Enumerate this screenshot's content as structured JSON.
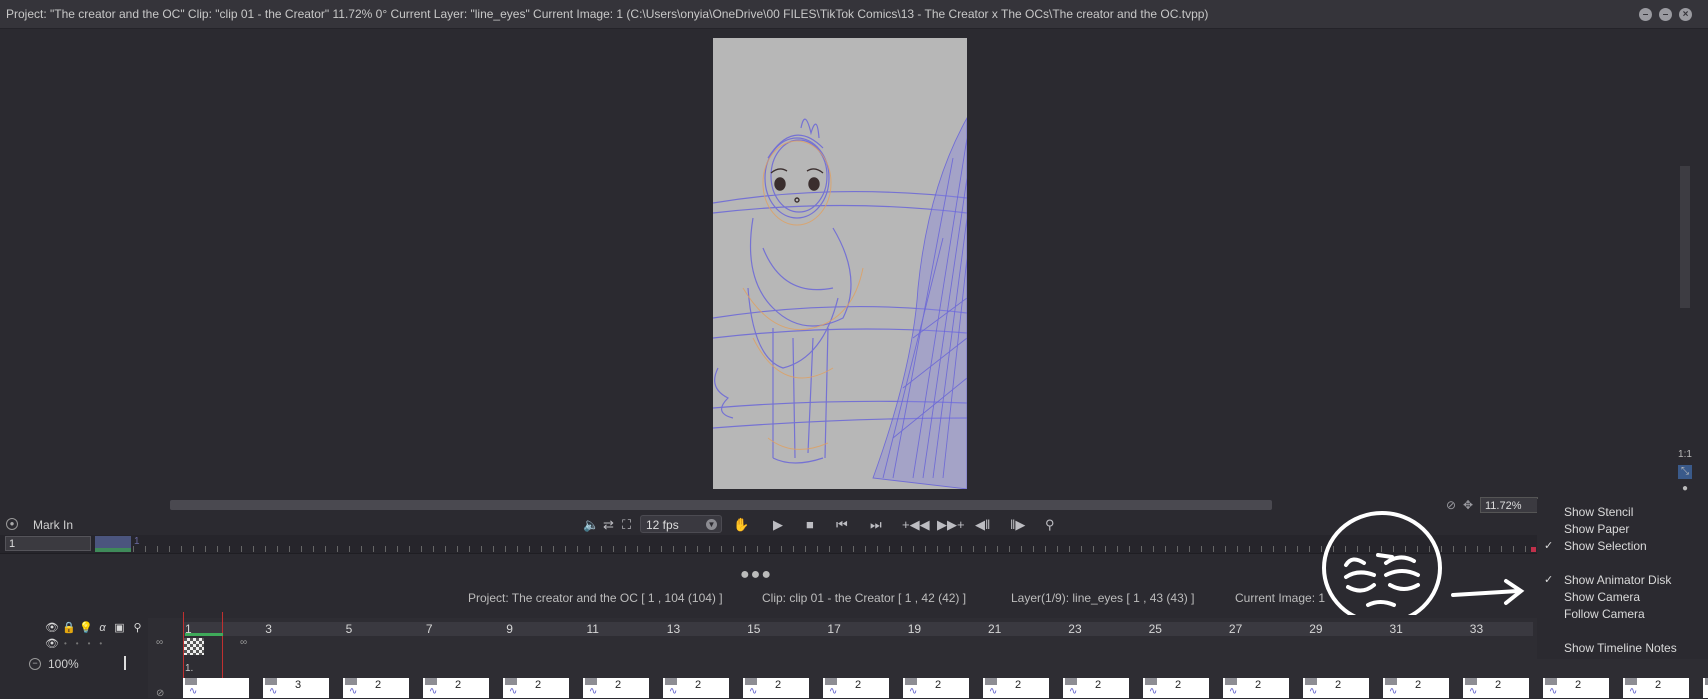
{
  "titlebar": {
    "text": "Project:  \"The creator and the OC\"  Clip: \"clip 01 - the Creator\"   11.72%   0°  Current Layer: \"line_eyes\"  Current Image: 1 (C:\\Users\\onyia\\OneDrive\\00 FILES\\TikTok Comics\\13 - The Creator x The OCs\\The creator and the OC.tvpp)",
    "btn_minimize": "–",
    "btn_restore": "–",
    "btn_close": "×"
  },
  "viewport": {
    "zoom": "11.72%",
    "ratio_label": "1:1"
  },
  "transport": {
    "mark_in": "Mark In",
    "fps": "12 fps"
  },
  "ruler": {
    "frame_value": "1",
    "range_end": "1"
  },
  "infobar": {
    "project": "Project: The creator and the OC [ 1 , 104  (104) ]",
    "clip": "Clip: clip 01 - the Creator [ 1 , 42  (42) ]",
    "layer": "Layer(1/9): line_eyes [ 1 , 43  (43) ]",
    "image": "Current Image: 1"
  },
  "timeline": {
    "opacity": "100%",
    "frame_numbers": [
      "1",
      "3",
      "5",
      "7",
      "9",
      "11",
      "13",
      "15",
      "17",
      "19",
      "21",
      "23",
      "25",
      "27",
      "29",
      "31",
      "33"
    ],
    "cel_label": "1.",
    "thumb_counts": [
      "3",
      "2",
      "2",
      "2",
      "2",
      "2",
      "2",
      "2",
      "2",
      "2",
      "2",
      "2",
      "2",
      "2",
      "2",
      "2",
      "2",
      "2",
      "2",
      "2"
    ]
  },
  "menu": {
    "items": [
      {
        "label": "Show Stencil",
        "checked": false
      },
      {
        "label": "Show Paper",
        "checked": false
      },
      {
        "label": "Show Selection",
        "checked": true
      },
      {
        "label": "Show Animator Disk",
        "checked": true
      },
      {
        "label": "Show Camera",
        "checked": false
      },
      {
        "label": "Follow Camera",
        "checked": false
      },
      {
        "label": "Show Timeline Notes",
        "checked": false
      }
    ]
  },
  "colors": {
    "background": "#2b2a30",
    "paper": "#b7b7b7",
    "sketch_blue": "#6a66d8",
    "sketch_orange": "#e0a060",
    "playhead_red": "#c03030"
  }
}
